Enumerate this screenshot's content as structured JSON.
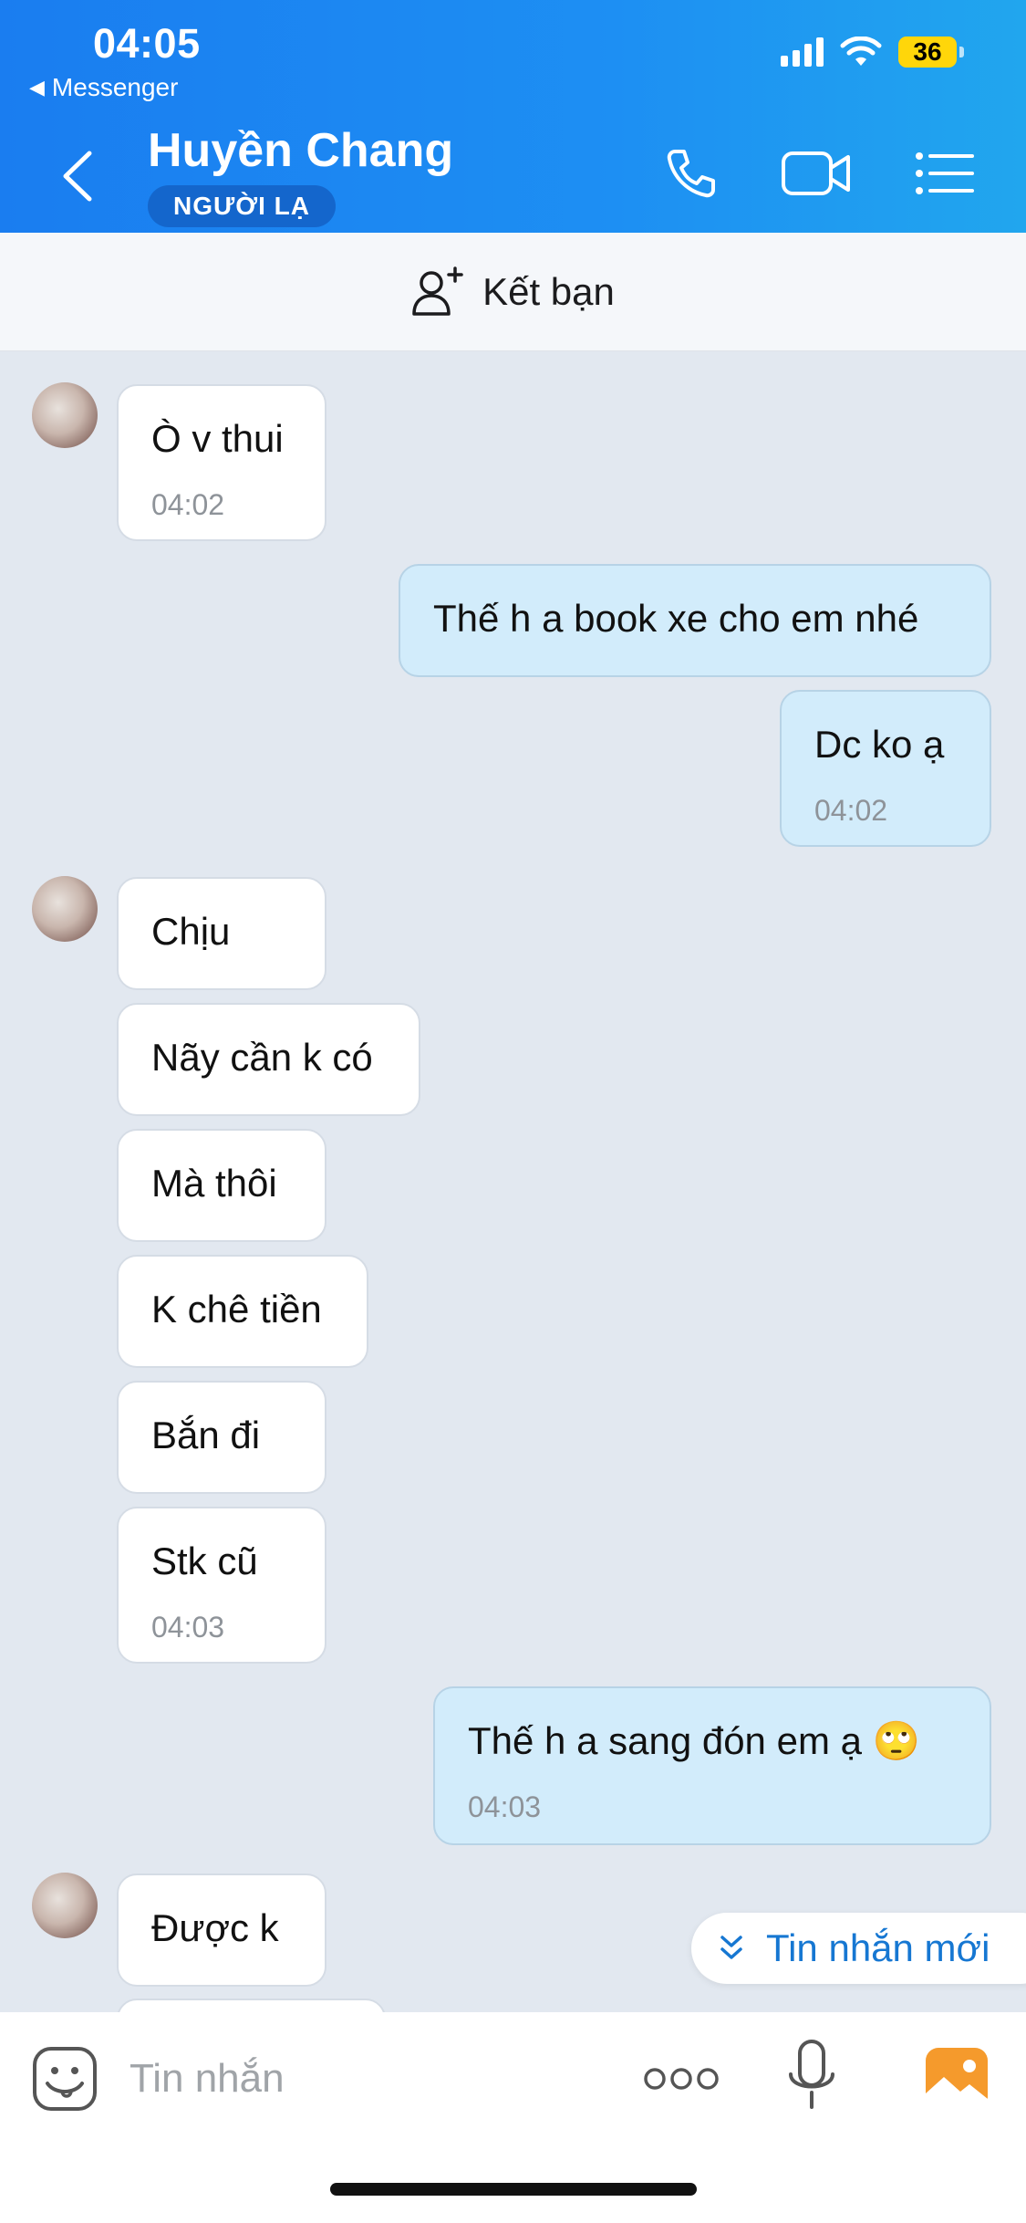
{
  "status_bar": {
    "time": "04:05",
    "back_app": "Messenger",
    "battery": "36"
  },
  "header": {
    "contact_name": "Huyền Chang",
    "badge": "NGƯỜI LẠ"
  },
  "add_friend": {
    "label": "Kết bạn"
  },
  "messages": [
    {
      "side": "in",
      "text": "Ò v thui",
      "time": "04:02"
    },
    {
      "side": "out",
      "text": "Thế h a book xe cho em nhé"
    },
    {
      "side": "out",
      "text": "Dc ko ạ",
      "time": "04:02"
    },
    {
      "side": "in",
      "text": "Chịu"
    },
    {
      "side": "in",
      "text": "Nãy cần k có"
    },
    {
      "side": "in",
      "text": "Mà thôi"
    },
    {
      "side": "in",
      "text": "K chê tiền"
    },
    {
      "side": "in",
      "text": "Bắn đi"
    },
    {
      "side": "in",
      "text": "Stk cũ",
      "time": "04:03"
    },
    {
      "side": "out",
      "text": "Thế h a sang đón em ạ 🙄",
      "time": "04:03"
    },
    {
      "side": "in",
      "text": "Được k"
    }
  ],
  "new_messages_button": {
    "label": "Tin nhắn mới"
  },
  "composer": {
    "placeholder": "Tin nhắn"
  },
  "colors": {
    "header": "#1a7df0",
    "outgoing_bubble": "#d2ecfb",
    "incoming_bubble": "#ffffff",
    "chat_background": "#e2e8f0",
    "accent": "#1677d2"
  },
  "icons": [
    "back-icon",
    "phone-icon",
    "video-call-icon",
    "list-menu-icon",
    "add-friend-icon",
    "sticker-icon",
    "more-icon",
    "microphone-icon",
    "image-icon",
    "chevrons-down-icon"
  ]
}
